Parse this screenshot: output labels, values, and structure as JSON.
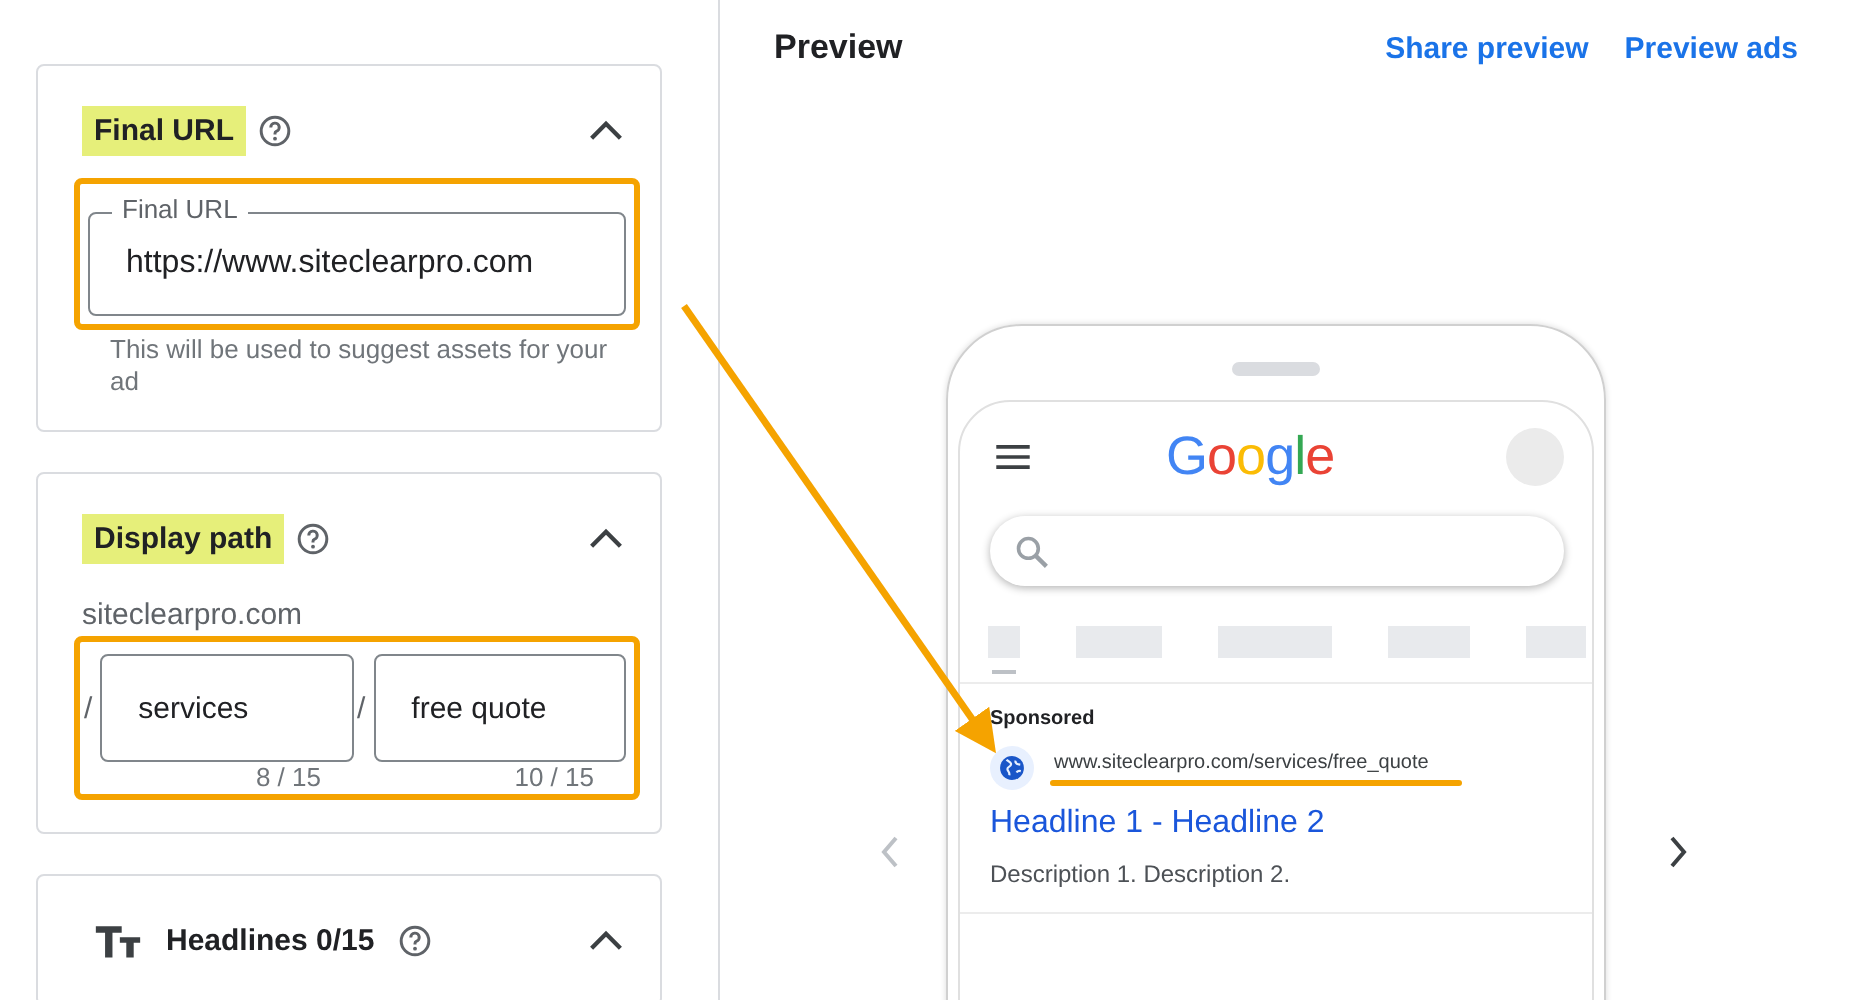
{
  "final_url": {
    "title": "Final URL",
    "highlighted": true,
    "expanded": true,
    "field": {
      "label": "Final URL",
      "value": "https://www.siteclearpro.com"
    },
    "hint": "This will be used to suggest assets for your ad"
  },
  "display_path": {
    "title": "Display path",
    "highlighted": true,
    "expanded": true,
    "domain": "siteclearpro.com",
    "paths": [
      {
        "separator": "/",
        "value": "services",
        "counter": "8 / 15"
      },
      {
        "separator": "/",
        "value": "free quote",
        "counter": "10 / 15"
      }
    ]
  },
  "headlines": {
    "title": "Headlines 0/15",
    "highlighted": false,
    "expanded": true
  },
  "preview": {
    "title": "Preview",
    "links": [
      "Share preview",
      "Preview ads"
    ],
    "logo": "Google",
    "ad": {
      "label": "Sponsored",
      "url": "www.siteclearpro.com/services/free_quote",
      "headline": "Headline 1 - Headline 2",
      "description": "Description 1. Description 2."
    }
  }
}
